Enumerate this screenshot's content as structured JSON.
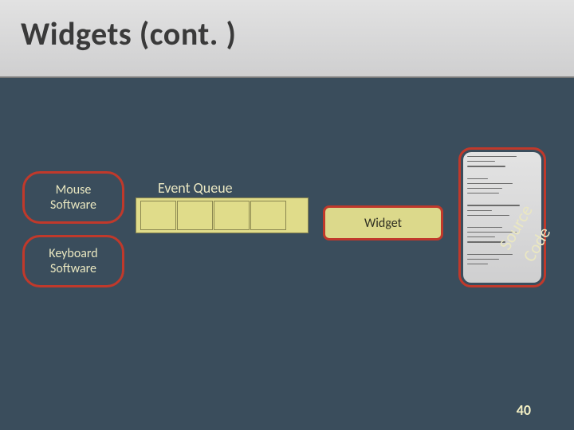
{
  "title": "Widgets (cont. )",
  "sw": {
    "mouse": "Mouse\nSoftware",
    "keyboard": "Keyboard\nSoftware"
  },
  "queue_label": "Event Queue",
  "widget_label": "Widget",
  "rotated": {
    "source": "Source",
    "code": "Code"
  },
  "page_number": "40"
}
